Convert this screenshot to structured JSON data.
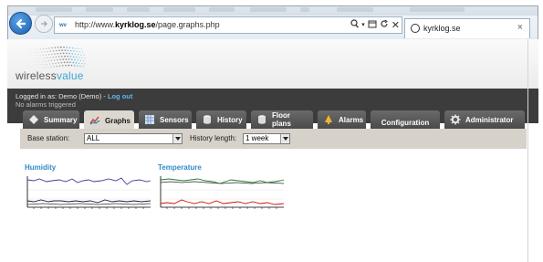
{
  "browser": {
    "url_prefix": "http://www.",
    "url_domain": "kyrklog.se",
    "url_suffix": "/page.graphs.php",
    "tab_title": "kyrklog.se",
    "favicon_text": "wv"
  },
  "header": {
    "logo_prefix": "wireless",
    "logo_accent": "value"
  },
  "login": {
    "logged_in_label": "Logged in as: Demo (Demo) - ",
    "logout_label": "Log out",
    "alarm_status": "No alarms triggered"
  },
  "nav": {
    "tabs": [
      {
        "label": "Summary",
        "icon": "diamond-icon"
      },
      {
        "label": "Graphs",
        "icon": "graph-icon"
      },
      {
        "label": "Sensors",
        "icon": "grid-icon"
      },
      {
        "label": "History",
        "icon": "cylinder-icon"
      },
      {
        "label": "Floor plans",
        "icon": "cylinder-icon"
      },
      {
        "label": "Alarms",
        "icon": "bell-icon"
      },
      {
        "label": "Configuration",
        "icon": ""
      },
      {
        "label": "Administrator",
        "icon": "gear-icon"
      }
    ],
    "active": "Graphs"
  },
  "controls": {
    "base_station_label": "Base station:",
    "base_station_value": "ALL",
    "history_length_label": "History length:",
    "history_length_value": "1 week"
  },
  "graphs": {
    "humidity_title": "Humidity",
    "temperature_title": "Temperature"
  },
  "colors": {
    "accent": "#2f8cc9",
    "dark_bar": "#3c3c3c",
    "active_tab": "#dcd8cf",
    "series_purple": "#4b3f9c",
    "series_green": "#2e7d32",
    "series_red": "#cc1111"
  }
}
